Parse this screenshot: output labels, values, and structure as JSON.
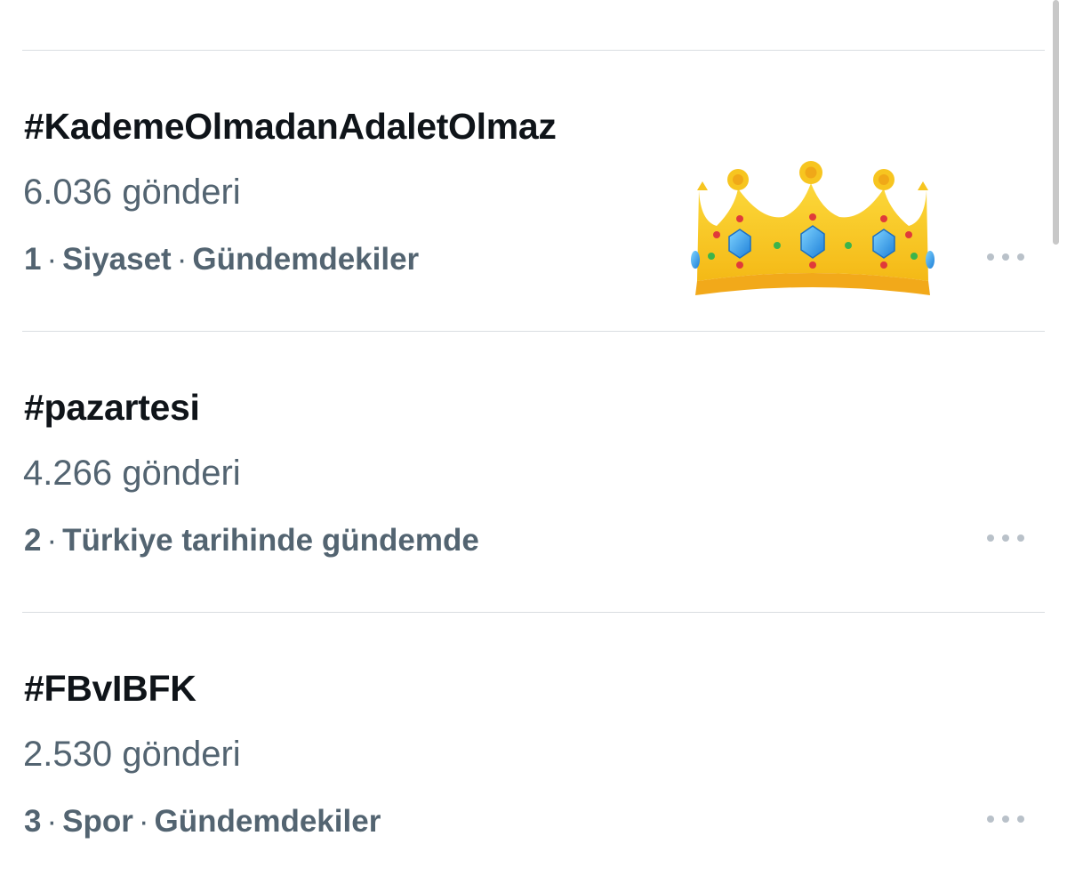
{
  "trends": [
    {
      "hashtag": "#KademeOlmadanAdaletOlmaz",
      "posts": "6.036 gönderi",
      "rank": "1",
      "separator": "·",
      "category": "Siyaset",
      "context": "Gündemdekiler",
      "emoji": "crown-icon"
    },
    {
      "hashtag": "#pazartesi",
      "posts": "4.266 gönderi",
      "rank": "2",
      "separator": "·",
      "category": "Türkiye tarihinde gündemde"
    },
    {
      "hashtag": "#FBvIBFK",
      "posts": "2.530 gönderi",
      "rank": "3",
      "separator": "·",
      "category": "Spor",
      "context": "Gündemdekiler"
    }
  ],
  "colors": {
    "primary_text": "#0f1419",
    "secondary_text": "#536471",
    "divider": "#d9dde1",
    "more_dots": "#b9c1c9",
    "crown_gold": "#f7c520"
  }
}
